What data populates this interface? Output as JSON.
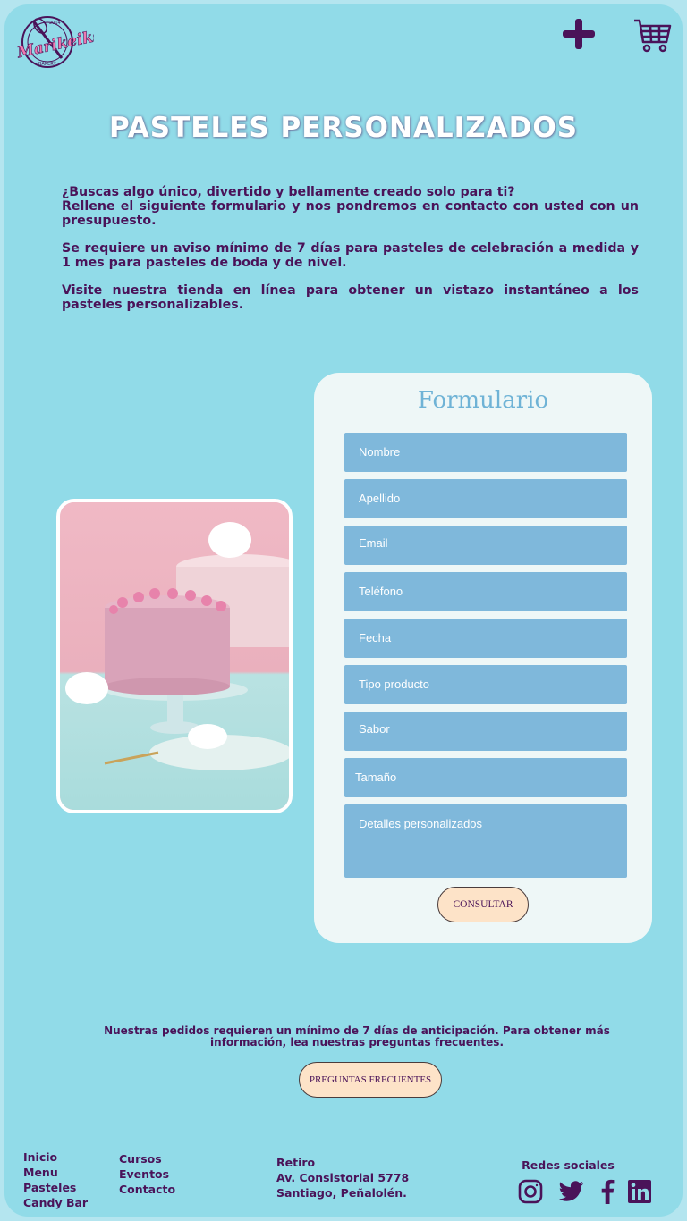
{
  "brand": {
    "logo_text": "Marikeiks",
    "logo_year": "2014",
    "logo_sub": "BAKERY"
  },
  "header": {
    "add_icon": "plus-icon",
    "cart_icon": "cart-icon"
  },
  "page": {
    "title": "PASTELES PERSONALIZADOS",
    "intro_line1": "¿Buscas algo único, divertido y bellamente creado solo para ti?",
    "intro_line2": "Rellene el siguiente formulario y nos pondremos en contacto con usted con un presupuesto.",
    "intro_p2": "Se requiere un aviso mínimo de 7 días para pasteles de celebración a medida y 1 mes para pasteles de boda y de nivel.",
    "intro_p3": "Visite nuestra tienda en línea para obtener un vistazo instantáneo a los pasteles personalizables."
  },
  "form": {
    "title": "Formulario",
    "fields": {
      "nombre": "Nombre",
      "apellido": "Apellido",
      "email": "Email",
      "telefono": "Teléfono",
      "fecha": "Fecha",
      "tipo": "Tipo producto",
      "sabor": "Sabor",
      "tamano": "Tamaño",
      "detalles": "Detalles personalizados"
    },
    "submit_label": "CONSULTAR"
  },
  "notice": {
    "text": "Nuestras pedidos requieren un mínimo de 7 días de anticipación. Para obtener más información, lea nuestras preguntas frecuentes.",
    "faq_label": "PREGUNTAS FRECUENTES"
  },
  "footer": {
    "col1": [
      "Inicio",
      "Menu",
      "Pasteles",
      "Candy Bar"
    ],
    "col2": [
      "Cursos",
      "Eventos",
      "Contacto"
    ],
    "address": [
      "Retiro",
      "Av. Consistorial 5778",
      "Santiago, Peñalolén."
    ],
    "social_title": "Redes sociales",
    "social_icons": [
      "instagram-icon",
      "twitter-icon",
      "facebook-icon",
      "linkedin-icon"
    ]
  },
  "colors": {
    "background": "#91dbe8",
    "accent": "#4a1359",
    "field": "#7fb8db",
    "button": "#fde3c8",
    "card": "#eef7f7"
  }
}
